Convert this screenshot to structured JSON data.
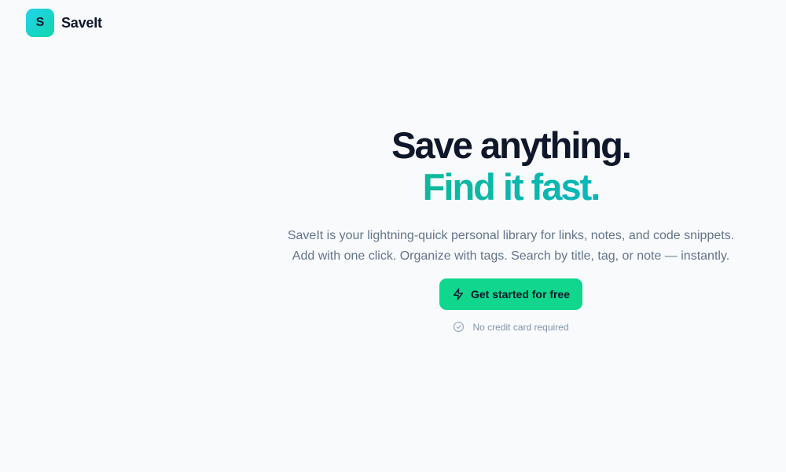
{
  "brand": {
    "logo_letter": "S",
    "name": "SaveIt"
  },
  "hero": {
    "headline_line1": "Save anything.",
    "headline_line2": "Find it fast.",
    "subtitle": "SaveIt is your lightning-quick personal library for links, notes, and code snippets. Add with one click. Organize with tags. Search by title, tag, or note — instantly.",
    "cta_label": "Get started for free",
    "cta_icon": "lightning-icon",
    "note_text": "No credit card required",
    "note_icon": "check-circle-icon"
  },
  "colors": {
    "background": "#f8fafc",
    "heading": "#0f172a",
    "accent_green": "#10d68e",
    "accent_gradient_start": "#10b981",
    "accent_gradient_end": "#06b6d4",
    "muted_text": "#64748b"
  }
}
